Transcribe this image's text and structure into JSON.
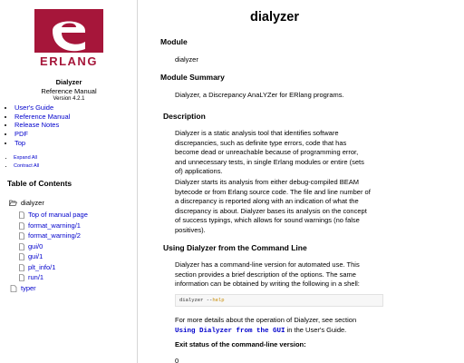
{
  "sidebar": {
    "logo_text": "ERLANG",
    "app_name": "Dialyzer",
    "manual_title": "Reference Manual",
    "version": "Version 4.2.1",
    "nav_links": [
      "User's Guide",
      "Reference Manual",
      "Release Notes",
      "PDF",
      "Top"
    ],
    "expand_all": "Expand All",
    "contract_all": "Contract All",
    "toc_title": "Table of Contents",
    "toc": {
      "module": "dialyzer",
      "items": [
        "Top of manual page",
        "format_warning/1",
        "format_warning/2",
        "gui/0",
        "gui/1",
        "plt_info/1",
        "run/1"
      ],
      "next_module": "typer"
    }
  },
  "main": {
    "title": "dialyzer",
    "module_heading": "Module",
    "module_name": "dialyzer",
    "summary_heading": "Module Summary",
    "summary_text": "Dialyzer, a Discrepancy AnaLYZer for ERlang programs.",
    "description_heading": "Description",
    "description_p1": [
      "Dialyzer is a static analysis tool that identifies software",
      "discrepancies, such as definite type errors, code that has",
      "become dead or unreachable because of programming error,",
      "and unnecessary tests, in single Erlang modules or entire (sets",
      "of) applications."
    ],
    "description_p2": [
      "Dialyzer starts its analysis from either debug-compiled BEAM",
      "bytecode or from Erlang source code. The file and line number of",
      "a discrepancy is reported along with an indication of what the",
      "discrepancy is about. Dialyzer bases its analysis on the concept",
      "of success typings, which allows for sound warnings (no false",
      "positives)."
    ],
    "cli_heading": "Using Dialyzer from the Command Line",
    "cli_p1": [
      "Dialyzer has a command-line version for automated use. This",
      "section provides a brief description of the options. The same",
      "information can be obtained by writing the following in a shell:"
    ],
    "code_cmd": "dialyzer --",
    "code_flag": "help",
    "more_details_prefix": "For more details about the operation of Dialyzer, see section",
    "more_details_link": "Using Dialyzer from the GUI",
    "more_details_suffix": " in the User's Guide.",
    "exit_status_heading": "Exit status of the command-line version:",
    "exit_code": "0"
  },
  "colors": {
    "link": "#0000cc",
    "logo_red": "#a6163a",
    "code_flag": "#c78a00"
  }
}
